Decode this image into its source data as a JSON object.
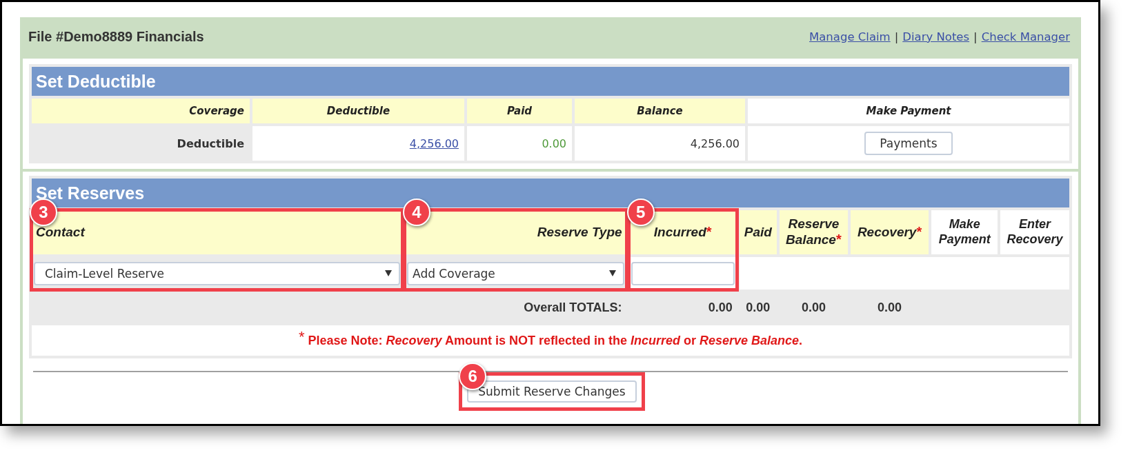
{
  "header": {
    "title": "File #Demo8889 Financials",
    "nav": [
      {
        "kind": "link",
        "text": "Manage Claim"
      },
      {
        "kind": "separator",
        "text": "|"
      },
      {
        "kind": "link",
        "text": "Diary Notes"
      },
      {
        "kind": "separator",
        "text": "|"
      },
      {
        "kind": "link",
        "text": "Check Manager"
      }
    ]
  },
  "deductible": {
    "title": "Set Deductible",
    "columns": [
      {
        "label": "Coverage",
        "kind": "data"
      },
      {
        "label": "Deductible",
        "kind": "data"
      },
      {
        "label": "Paid",
        "kind": "data"
      },
      {
        "label": "Balance",
        "kind": "data"
      },
      {
        "label": "Make Payment",
        "kind": "action"
      }
    ],
    "rows": [
      {
        "cells": [
          {
            "kind": "label",
            "text": "Deductible"
          },
          {
            "kind": "link",
            "text": "4,256.00"
          },
          {
            "kind": "paid",
            "text": "0.00"
          },
          {
            "kind": "amount",
            "text": "4,256.00"
          },
          {
            "kind": "button",
            "text": "Payments"
          }
        ]
      }
    ]
  },
  "reserves": {
    "title": "Set Reserves",
    "columns": [
      {
        "label": "Contact",
        "kind": "data",
        "callout": "3"
      },
      {
        "label": "Reserve Type",
        "kind": "data",
        "callout": "4"
      },
      {
        "label": "Incurred",
        "kind": "data",
        "mark": "*",
        "callout": "5"
      },
      {
        "label": "Paid",
        "kind": "data"
      },
      {
        "label": "Reserve Balance",
        "kind": "data",
        "mark": "*"
      },
      {
        "label": "Recovery",
        "kind": "data",
        "mark": "*"
      },
      {
        "label": "Make Payment",
        "kind": "action"
      },
      {
        "label": "Enter Recovery",
        "kind": "action"
      }
    ],
    "inputs": [
      {
        "kind": "dropdown",
        "value": "Claim-Level Reserve"
      },
      {
        "kind": "dropdown",
        "value": "Add Coverage"
      },
      {
        "kind": "text"
      }
    ],
    "totals": {
      "label": "Overall TOTALS:",
      "values": [
        "0.00",
        "0.00",
        "0.00",
        "0.00"
      ]
    },
    "note": "$^{*}$ Please Note: *Recovery* Amount is NOT reflected in the *Incurred* or *Reserve Balance*.",
    "submit": {
      "label": "Submit Reserve Changes",
      "callout": "6"
    }
  }
}
